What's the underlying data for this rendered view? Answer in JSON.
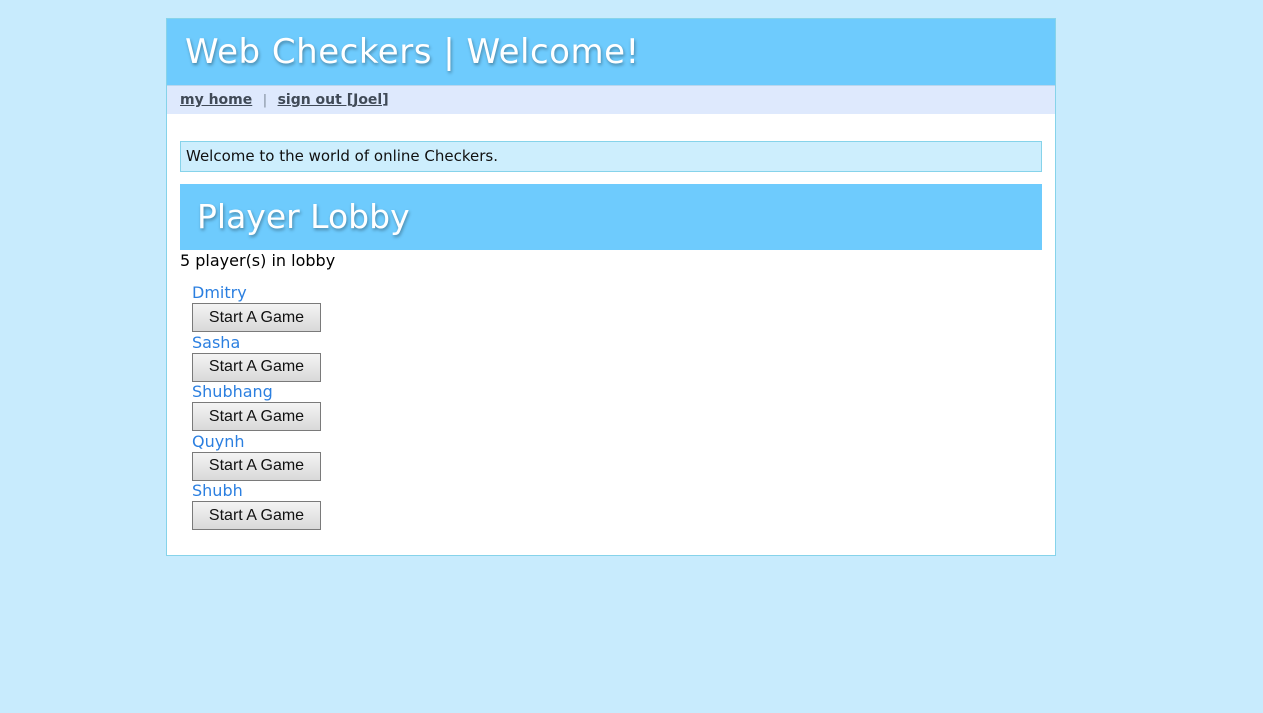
{
  "header": {
    "title": "Web Checkers | Welcome!"
  },
  "nav": {
    "home_label": "my home",
    "separator": "|",
    "signout_label": "sign out [Joel]"
  },
  "info": {
    "message": "Welcome to the world of online Checkers."
  },
  "lobby": {
    "title": "Player Lobby",
    "count_text": "5 player(s) in lobby",
    "players": [
      {
        "name": "Dmitry",
        "button_label": "Start A Game"
      },
      {
        "name": "Sasha",
        "button_label": "Start A Game"
      },
      {
        "name": "Shubhang",
        "button_label": "Start A Game"
      },
      {
        "name": "Quynh",
        "button_label": "Start A Game"
      },
      {
        "name": "Shubh",
        "button_label": "Start A Game"
      }
    ]
  },
  "colors": {
    "background": "#c8ebfd",
    "header": "#6ecbfd",
    "nav": "#dee9fd",
    "player_link": "#2b7fe0"
  }
}
